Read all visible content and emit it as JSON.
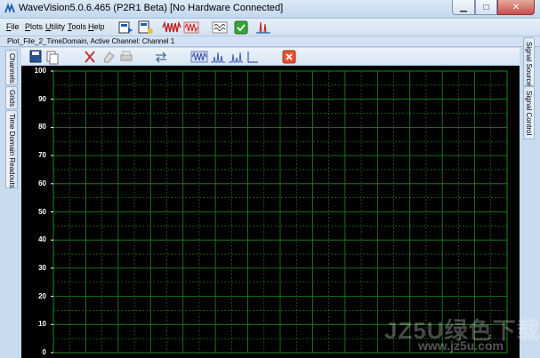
{
  "window": {
    "title": "WaveVision5.0.6.465 (P2R1 Beta)  [No Hardware Connected]",
    "app_icon": "wavevision-logo-icon",
    "controls": [
      "minimize-icon",
      "maximize-icon",
      "close-icon"
    ]
  },
  "menu": {
    "items": [
      {
        "label": "File",
        "key": "F"
      },
      {
        "label": "Plots",
        "key": "P"
      },
      {
        "label": "Utility",
        "key": "U"
      },
      {
        "label": "Tools",
        "key": "T"
      },
      {
        "label": "Help",
        "key": "H"
      }
    ]
  },
  "toolbar_icons": [
    "open-file-icon",
    "new-file-icon",
    "waveform-red-icon",
    "waveform-red-stack-icon",
    "dual-wave-icon",
    "green-check-icon",
    "spectrum-icon"
  ],
  "document": {
    "title": "Plot_File_2_TimeDomain,  Active Channel: Channel 1"
  },
  "left_tabs": [
    "Channels",
    "Grids",
    "Time Domain Readouts"
  ],
  "right_tabs": [
    "Signal Sources",
    "Signal Control"
  ],
  "plot_toolbar_icons": [
    "save-icon",
    "copy-icon",
    "cut-icon",
    "eraser-icon",
    "print-icon",
    "swap-icon",
    "time-domain-icon",
    "spectrum-blue-icon",
    "histogram-blue-icon",
    "axis-icon",
    "delete-icon"
  ],
  "colors": {
    "plot_background": "#000000",
    "grid_line": "#1f8a1f",
    "tick_label": "#ffffff",
    "close_accent": "#c75050"
  },
  "chart_data": {
    "type": "line",
    "title": "",
    "xlabel": "",
    "ylabel": "",
    "ylim": [
      0,
      100
    ],
    "y_ticks": [
      "100",
      "90",
      "80",
      "70",
      "60",
      "50",
      "40",
      "30",
      "20",
      "10",
      "0"
    ],
    "grid": true,
    "series": []
  },
  "watermark": {
    "text": "JZ5U绿色下载",
    "url": "www.jz5u.com"
  }
}
